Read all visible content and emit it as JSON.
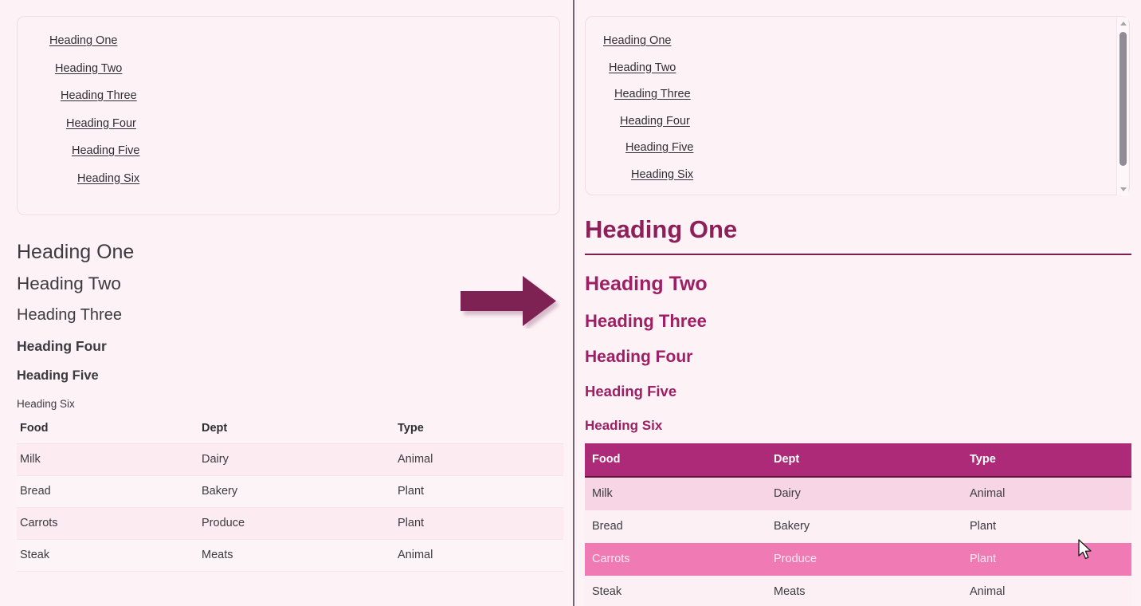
{
  "colors": {
    "page_background": "#fdf2f6",
    "divider": "#6f6470",
    "link_text": "#2f2f33",
    "plain_heading_text": "#3b3b40",
    "styled_heading_primary": "#8e2059",
    "styled_heading_secondary": "#9e1f63",
    "styled_heading_rule": "#7d1f4f",
    "table_header_background": "#ad2a78",
    "table_header_text": "#ffffff",
    "table_stripe_row": "#f8d5e5",
    "table_hover_row": "#f07ab4",
    "arrow_fill": "#7d2053"
  },
  "toc": {
    "links": [
      {
        "label": "Heading One",
        "level": 1
      },
      {
        "label": "Heading Two",
        "level": 2
      },
      {
        "label": "Heading Three",
        "level": 3
      },
      {
        "label": "Heading Four",
        "level": 4
      },
      {
        "label": "Heading Five",
        "level": 5
      },
      {
        "label": "Heading Six",
        "level": 6
      }
    ]
  },
  "left_panel": {
    "headings": [
      {
        "label": "Heading One",
        "level": 1
      },
      {
        "label": "Heading Two",
        "level": 2
      },
      {
        "label": "Heading Three",
        "level": 3
      },
      {
        "label": "Heading Four",
        "level": 4
      },
      {
        "label": "Heading Five",
        "level": 5
      },
      {
        "label": "Heading Six",
        "level": 6
      }
    ],
    "table": {
      "columns": [
        "Food",
        "Dept",
        "Type"
      ],
      "rows": [
        [
          "Milk",
          "Dairy",
          "Animal"
        ],
        [
          "Bread",
          "Bakery",
          "Plant"
        ],
        [
          "Carrots",
          "Produce",
          "Plant"
        ],
        [
          "Steak",
          "Meats",
          "Animal"
        ]
      ]
    }
  },
  "right_panel": {
    "headings": [
      {
        "label": "Heading One",
        "level": 1
      },
      {
        "label": "Heading Two",
        "level": 2
      },
      {
        "label": "Heading Three",
        "level": 3
      },
      {
        "label": "Heading Four",
        "level": 4
      },
      {
        "label": "Heading Five",
        "level": 5
      },
      {
        "label": "Heading Six",
        "level": 6
      }
    ],
    "table": {
      "columns": [
        "Food",
        "Dept",
        "Type"
      ],
      "rows": [
        [
          "Milk",
          "Dairy",
          "Animal"
        ],
        [
          "Bread",
          "Bakery",
          "Plant"
        ],
        [
          "Carrots",
          "Produce",
          "Plant"
        ],
        [
          "Steak",
          "Meats",
          "Animal"
        ]
      ],
      "hovered_row_index": 2
    },
    "scrollbar": {
      "up_arrow": "scroll-up-arrow",
      "down_arrow": "scroll-down-arrow"
    }
  },
  "arrow": {
    "icon": "right-arrow-icon",
    "direction": "right"
  },
  "cursor": {
    "icon": "mouse-pointer-icon"
  }
}
